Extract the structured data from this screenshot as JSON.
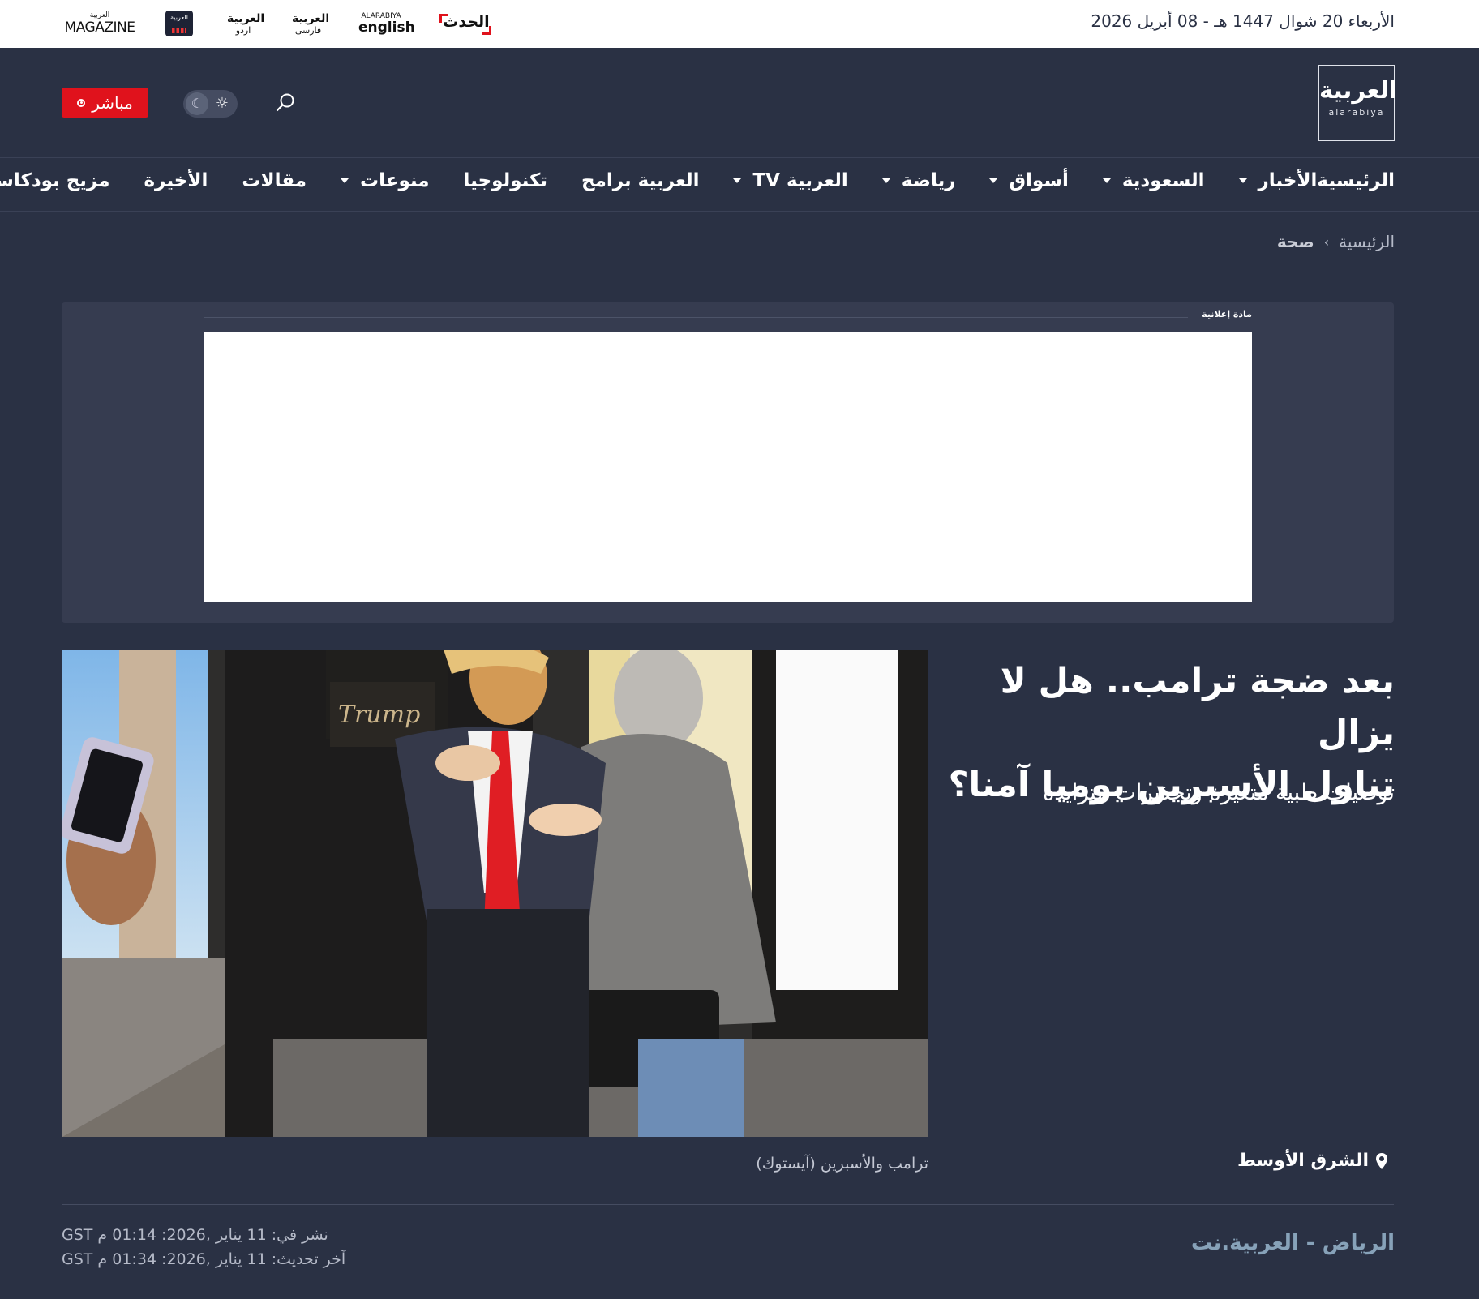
{
  "topbar": {
    "date": "الأربعاء 20 شوال 1447 هـ - 08 أبريل 2026",
    "brands": {
      "magazine_small": "العربية",
      "magazine": "MAGAZINE",
      "app": "العربية",
      "urdu_1": "العربية",
      "urdu_2": "اردو",
      "farsi_1": "العربية",
      "farsi_2": "فارسی",
      "english_1": "ALARABIYA",
      "english_2": "english",
      "hadath": "الحدث"
    }
  },
  "header": {
    "logo_ar": "العربية",
    "logo_en": "alarabiya",
    "live_label": "مباشر",
    "search_icon": "search-icon",
    "theme_toggle": {
      "moon": "moon-icon",
      "sun": "sun-icon"
    },
    "live_color": "#e0121c"
  },
  "nav": {
    "items": [
      {
        "label": "الرئيسية",
        "dropdown": false
      },
      {
        "label": "الأخبار",
        "dropdown": true
      },
      {
        "label": "السعودية",
        "dropdown": true
      },
      {
        "label": "أسواق",
        "dropdown": true
      },
      {
        "label": "رياضة",
        "dropdown": true
      },
      {
        "label": "العربية TV",
        "dropdown": true
      },
      {
        "label": "العربية برامج",
        "dropdown": false
      },
      {
        "label": "تكنولوجيا",
        "dropdown": false
      },
      {
        "label": "منوعات",
        "dropdown": true
      },
      {
        "label": "مقالات",
        "dropdown": false
      },
      {
        "label": "الأخيرة",
        "dropdown": false
      },
      {
        "label": "مزيج بودكاست",
        "dropdown": false
      }
    ]
  },
  "breadcrumb": {
    "home": "الرئيسية",
    "separator": "›",
    "current": "صحة"
  },
  "ad": {
    "label": "مادة إعلانية"
  },
  "article": {
    "headline_line1": "بعد ضجة ترامب.. هل لا يزال",
    "headline_line2": "تناول الأسبرين يوميا آمنا؟",
    "subheadline": "توصيات طبية متغيرة وتحذيرات متزايدة",
    "image_caption": "ترامب والأسبرين (آيستوك)",
    "region": "الشرق الأوسط",
    "dateline": "الرياض - العربية.نت",
    "published": "نشر في: 11 يناير ,2026: 01:14 م GST",
    "updated": "آخر تحديث: 11 يناير ,2026: 01:34 م GST"
  }
}
